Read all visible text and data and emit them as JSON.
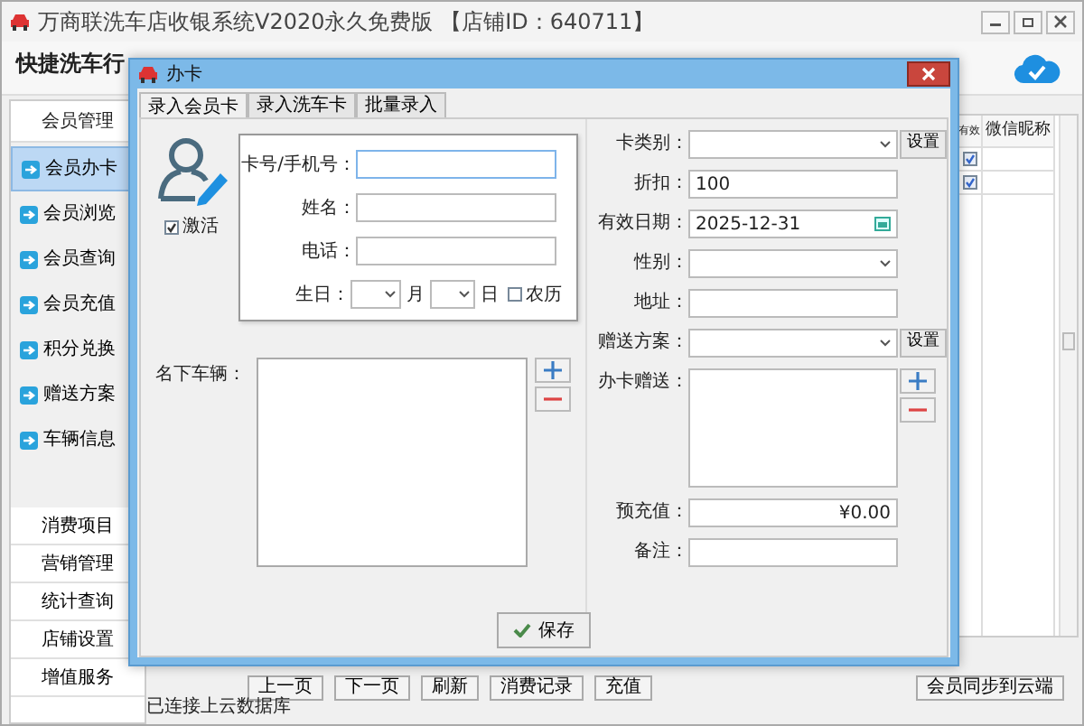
{
  "window": {
    "title": "万商联洗车店收银系统V2020永久免费版 【店铺ID：640711】"
  },
  "toolbar": {
    "logo": "快捷洗车行"
  },
  "sidebar": {
    "header": "会员管理",
    "items": [
      {
        "label": "会员办卡",
        "selected": true
      },
      {
        "label": "会员浏览",
        "selected": false
      },
      {
        "label": "会员查询",
        "selected": false
      },
      {
        "label": "会员充值",
        "selected": false
      },
      {
        "label": "积分兑换",
        "selected": false
      },
      {
        "label": "赠送方案",
        "selected": false
      },
      {
        "label": "车辆信息",
        "selected": false
      }
    ],
    "sections": [
      "消费项目",
      "营销管理",
      "统计查询",
      "店铺设置",
      "增值服务"
    ]
  },
  "member_table": {
    "columns": [
      "有效",
      "微信昵称"
    ],
    "rows": [
      {
        "checked": true
      },
      {
        "checked": true
      }
    ]
  },
  "bottom_buttons": [
    "上一页",
    "下一页",
    "刷新",
    "消费记录",
    "充值"
  ],
  "sync_button": "会员同步到云端",
  "status_bar": "已连接上云数据库",
  "dialog": {
    "title": "办卡",
    "tabs": [
      {
        "label": "录入会员卡",
        "selected": true
      },
      {
        "label": "录入洗车卡",
        "selected": false
      },
      {
        "label": "批量录入",
        "selected": false
      }
    ],
    "activate": {
      "label": "激活",
      "checked": true
    },
    "basic_fields": [
      {
        "kind": "text",
        "label": "卡号/手机号：",
        "focused": true
      },
      {
        "kind": "text",
        "label": "姓名：",
        "focused": false
      },
      {
        "kind": "text",
        "label": "电话：",
        "focused": false
      },
      {
        "kind": "birthday",
        "label": "生日：",
        "month_label": "月",
        "day_label": "日",
        "lunar": {
          "label": "农历",
          "checked": false
        }
      }
    ],
    "vehicles": {
      "label": "名下车辆："
    },
    "detail_fields": [
      {
        "kind": "select",
        "label": "卡类别：",
        "button": "设置"
      },
      {
        "kind": "text",
        "label": "折扣：",
        "value": "100"
      },
      {
        "kind": "date",
        "label": "有效日期：",
        "value": "2025-12-31"
      },
      {
        "kind": "select",
        "label": "性别："
      },
      {
        "kind": "text",
        "label": "地址："
      },
      {
        "kind": "select",
        "label": "赠送方案：",
        "button": "设置"
      },
      {
        "kind": "list",
        "label": "办卡赠送："
      },
      {
        "kind": "money",
        "label": "预充值：",
        "value": "¥0.00"
      },
      {
        "kind": "text",
        "label": "备注："
      }
    ],
    "save_button": "保存"
  }
}
